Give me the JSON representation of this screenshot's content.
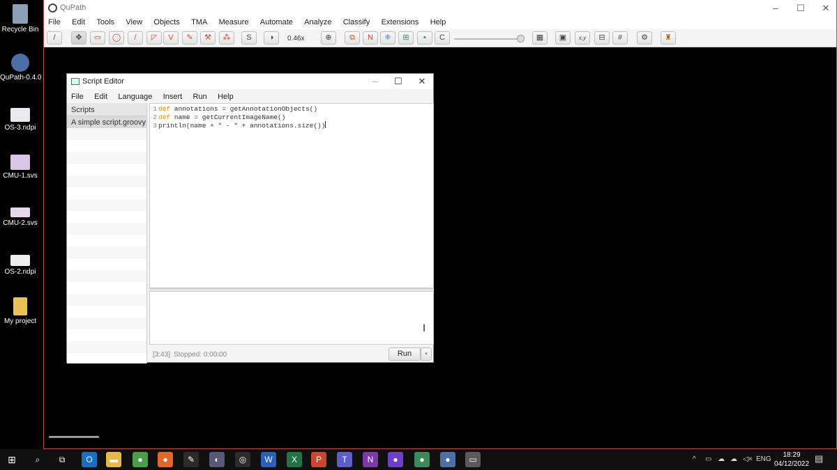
{
  "desktop": {
    "icons": [
      {
        "label": "Recycle Bin",
        "color": "#8aa0b8"
      },
      {
        "label": "QuPath-0.4.0",
        "color": "#4b6fa6"
      },
      {
        "label": "OS-3.ndpi",
        "color": "#e9e9ef"
      },
      {
        "label": "CMU-1.svs",
        "color": "#d9c6e6"
      },
      {
        "label": "CMU-2.svs",
        "color": "#e7d7ec"
      },
      {
        "label": "OS-2.ndpi",
        "color": "#eeeeee"
      },
      {
        "label": "My project",
        "color": "#e8c15a"
      }
    ]
  },
  "qupath": {
    "title": "QuPath",
    "menu": [
      "File",
      "Edit",
      "Tools",
      "View",
      "Objects",
      "TMA",
      "Measure",
      "Automate",
      "Analyze",
      "Classify",
      "Extensions",
      "Help"
    ],
    "zoom": "0.46x",
    "window_controls": [
      "–",
      "☐",
      "✕"
    ],
    "toolbar_icons": [
      "move-icon",
      "rectangle-icon",
      "ellipse-icon",
      "line-icon",
      "polygon-icon",
      "polyline-icon",
      "brush-icon",
      "wand-icon",
      "points-icon",
      "selection-mode-icon",
      "brightness-contrast-icon",
      "zoom-to-fit-icon",
      "show-annotations-icon",
      "show-names-icon",
      "show-tma-grid-icon",
      "show-detections-icon",
      "fill-detections-icon",
      "show-connections-icon",
      "show-measurement-table-icon",
      "show-overview-icon",
      "show-cursor-location-icon",
      "show-scalebar-icon",
      "show-grid-icon",
      "preferences-icon",
      "log-icon"
    ],
    "toolbar_labels": {
      "selection_mode": "S",
      "names": "N",
      "connections": "C",
      "location": "x,y",
      "polygon_v": "V"
    }
  },
  "script_editor": {
    "title": "Script Editor",
    "menu": [
      "File",
      "Edit",
      "Language",
      "Insert",
      "Run",
      "Help"
    ],
    "window_controls": [
      "–",
      "☐",
      "✕"
    ],
    "scripts_header": "Scripts",
    "scripts": [
      "A simple script.groovy"
    ],
    "code": [
      {
        "num": "1",
        "kw": "def",
        "text": " annotations = getAnnotationObjects()"
      },
      {
        "num": "2",
        "kw": "def",
        "text": " name = getCurrentImageName()"
      },
      {
        "num": "3",
        "kw": "",
        "text": "println(name + \" - \" + annotations.size())"
      }
    ],
    "cursor_position": "[3:43]",
    "status": "Stopped: 0:00:00",
    "run_label": "Run",
    "run_dropdown": "▾"
  },
  "taskbar": {
    "apps": [
      {
        "name": "outlook-icon",
        "glyph": "O",
        "color": "#1a6fc4"
      },
      {
        "name": "file-explorer-icon",
        "glyph": "▬",
        "color": "#e8b84a"
      },
      {
        "name": "chrome-icon",
        "glyph": "●",
        "color": "#4a9e4a"
      },
      {
        "name": "firefox-icon",
        "glyph": "●",
        "color": "#e2672a"
      },
      {
        "name": "inkscape-icon",
        "glyph": "✎",
        "color": "#2b2b2b"
      },
      {
        "name": "app-icon",
        "glyph": "◐",
        "color": "#555a7a"
      },
      {
        "name": "obs-icon",
        "glyph": "◎",
        "color": "#2b2b2b"
      },
      {
        "name": "word-icon",
        "glyph": "W",
        "color": "#2b5fb8"
      },
      {
        "name": "excel-icon",
        "glyph": "X",
        "color": "#217346"
      },
      {
        "name": "powerpoint-icon",
        "glyph": "P",
        "color": "#c8472d"
      },
      {
        "name": "teams-icon",
        "glyph": "T",
        "color": "#5b5fc7"
      },
      {
        "name": "onenote-icon",
        "glyph": "N",
        "color": "#7c3aa8"
      },
      {
        "name": "github-icon",
        "glyph": "●",
        "color": "#6e40c9"
      },
      {
        "name": "app2-icon",
        "glyph": "●",
        "color": "#3c8a5a"
      },
      {
        "name": "qupath-task-icon",
        "glyph": "●",
        "color": "#4b6fa6"
      },
      {
        "name": "active-window-icon",
        "glyph": "▭",
        "color": "#5a5a5a"
      }
    ],
    "lang": "ENG",
    "time": "18:29",
    "date": "04/12/2022"
  }
}
